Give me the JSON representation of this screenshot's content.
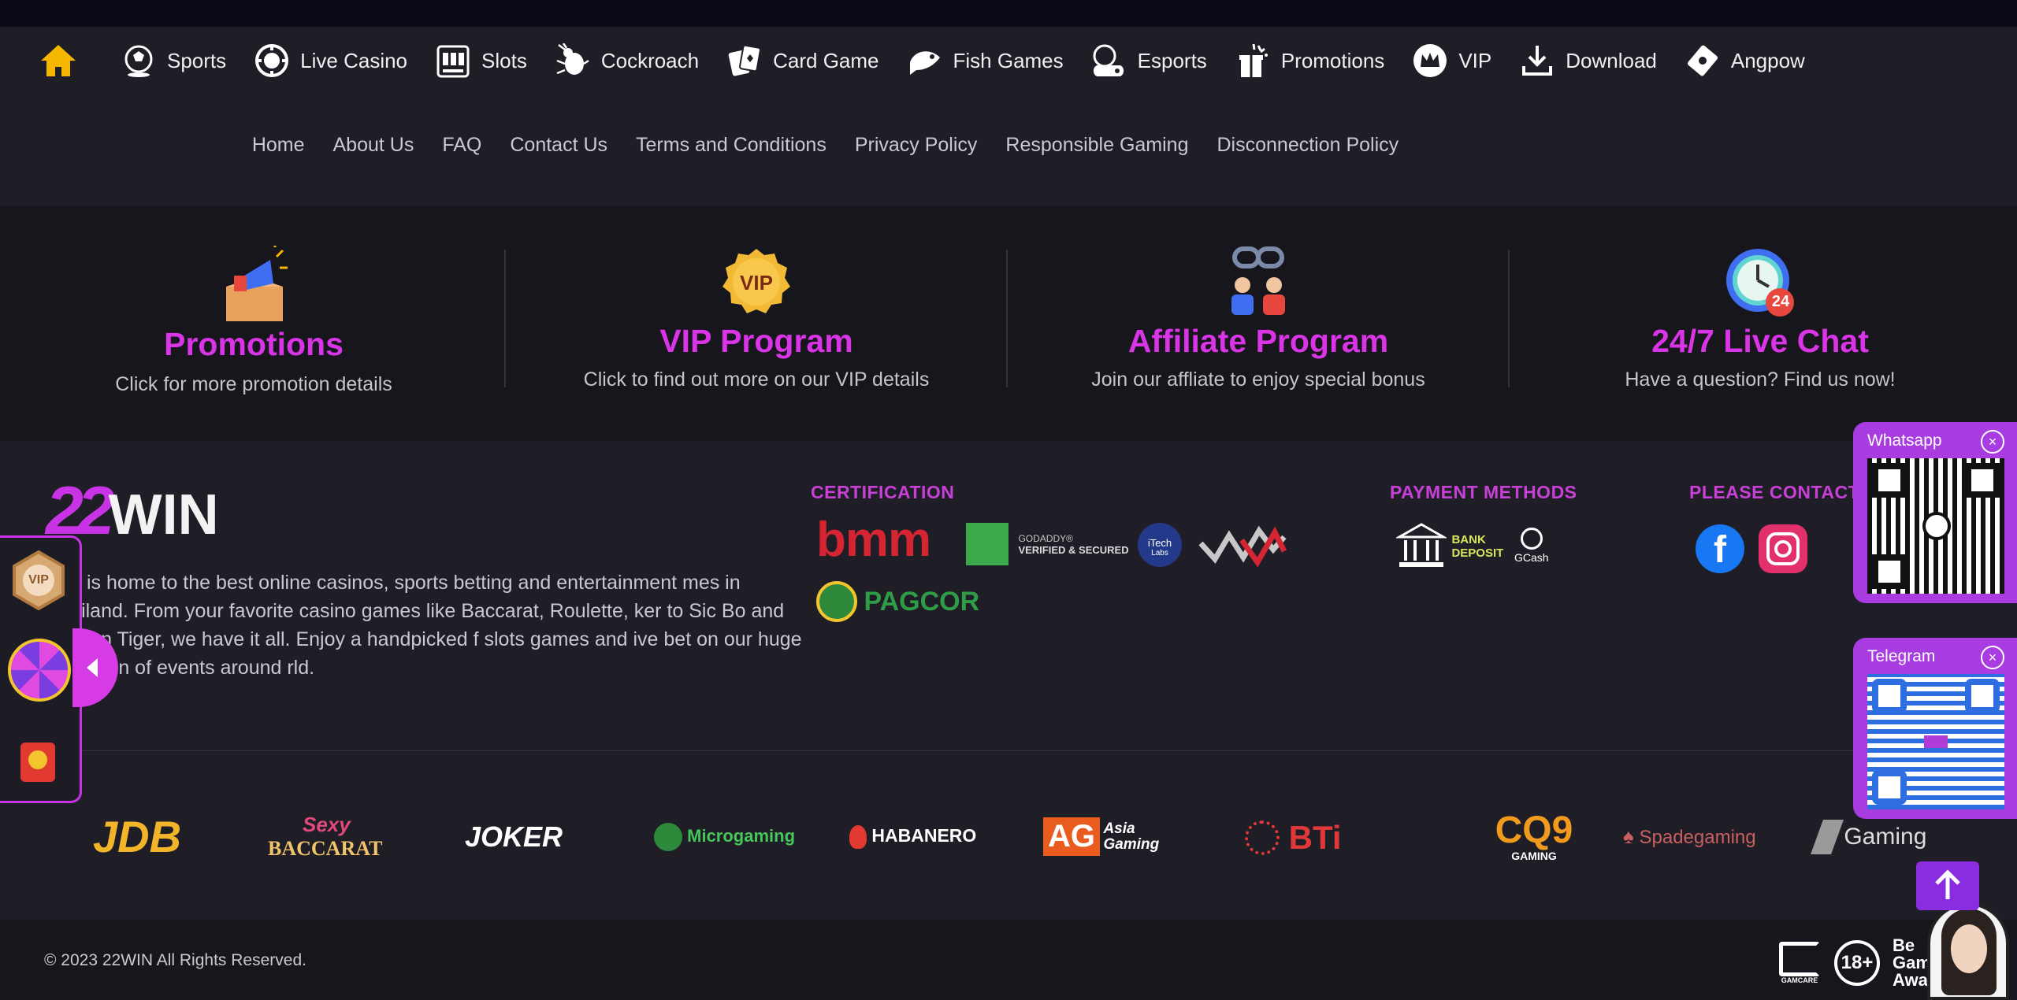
{
  "nav": {
    "home_label": "Home",
    "items": [
      {
        "label": "Sports",
        "icon": "soccer-ball-icon"
      },
      {
        "label": "Live Casino",
        "icon": "casino-chip-icon"
      },
      {
        "label": "Slots",
        "icon": "slot-machine-icon"
      },
      {
        "label": "Cockroach",
        "icon": "cockroach-icon"
      },
      {
        "label": "Card Game",
        "icon": "playing-cards-icon"
      },
      {
        "label": "Fish Games",
        "icon": "fish-icon"
      },
      {
        "label": "Esports",
        "icon": "gamepad-icon"
      },
      {
        "label": "Promotions",
        "icon": "gift-icon"
      },
      {
        "label": "VIP",
        "icon": "crown-icon"
      },
      {
        "label": "Download",
        "icon": "download-icon"
      },
      {
        "label": "Angpow",
        "icon": "red-envelope-icon"
      }
    ]
  },
  "links": [
    "Home",
    "About Us",
    "FAQ",
    "Contact Us",
    "Terms and Conditions",
    "Privacy Policy",
    "Responsible Gaming",
    "Disconnection Policy"
  ],
  "features": [
    {
      "title": "Promotions",
      "desc": "Click for more promotion details"
    },
    {
      "title": "VIP Program",
      "desc": "Click to find out more on our VIP details"
    },
    {
      "title": "Affiliate Program",
      "desc": "Join our affliate to enjoy special bonus"
    },
    {
      "title": "24/7 Live Chat",
      "desc": "Have a question? Find us now!"
    }
  ],
  "feature_icon_text": {
    "vip": "VIP",
    "chat": "24"
  },
  "brand": {
    "logo_num": "22",
    "logo_text": "WIN",
    "description": "Win is home to the best online casinos, sports betting and entertainment mes in Thailand. From your favorite casino games like Baccarat, Roulette, ker to Sic Bo and Dragon Tiger, we have it all. Enjoy a handpicked f slots games and ive bet on our huge collection of events around rld."
  },
  "sections": {
    "certification": "CERTIFICATION",
    "payment": "PAYMENT METHODS",
    "contact": "PLEASE CONTACT"
  },
  "cert": {
    "bmm": "bmm",
    "godaddy_line1": "GODADDY®",
    "godaddy_line2": "VERIFIED & SECURED",
    "itech_line1": "iTech",
    "itech_line2": "Labs",
    "pagcor": "PAGCOR"
  },
  "payment": {
    "bank_line1": "BANK",
    "bank_line2": "DEPOSIT",
    "gcash": "GCash"
  },
  "partners": [
    "JDB",
    "BACCARAT",
    "JOKER",
    "Microgaming",
    "HABANERO",
    "AG",
    "Asia Gaming",
    "BTi",
    "CQ9",
    "GAMING",
    "Spadegaming",
    "Gaming"
  ],
  "partner_sexy": "Sexy",
  "qr": {
    "whatsapp": "Whatsapp",
    "telegram": "Telegram",
    "close": "×"
  },
  "side": {
    "vip_badge": "VIP"
  },
  "footer": {
    "copyright": "© 2023 22WIN All Rights Reserved.",
    "gamcare": "GAMCARE",
    "age": "18+",
    "award_line1": "Be",
    "award_line2": "Gam",
    "award_line3": "Awar"
  },
  "colors": {
    "accent": "#d934e6",
    "background": "#1f1e27",
    "panel": "#17161d",
    "home_icon": "#f5b700"
  }
}
